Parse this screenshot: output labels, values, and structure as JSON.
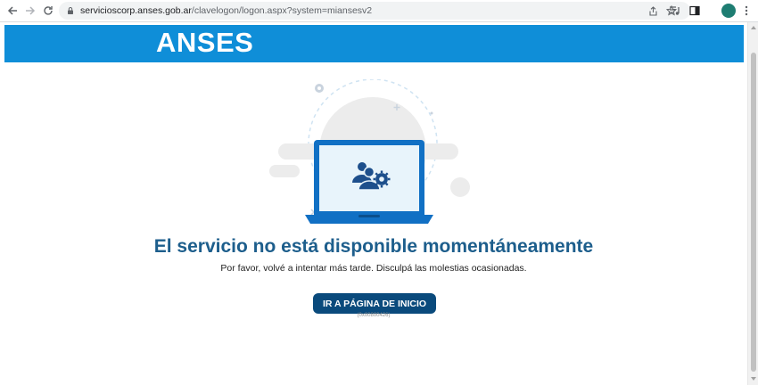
{
  "browser": {
    "url_host": "servicioscorp.anses.gob.ar",
    "url_path": "/clavelogon/logon.aspx?system=miansesv2"
  },
  "header": {
    "logo_text": "ANSES",
    "brand_color": "#0f8ed8"
  },
  "error": {
    "title": "El servicio no está disponible momentáneamente",
    "message": "Por favor, volvé a intentar más tarde. Disculpá las molestias ocasionadas.",
    "button_label": "IR A PÁGINA DE INICIO",
    "code": "(0x00800426)"
  },
  "colors": {
    "title": "#1d5e8c",
    "button": "#0a4a7c",
    "illustration": "#1170c4"
  }
}
